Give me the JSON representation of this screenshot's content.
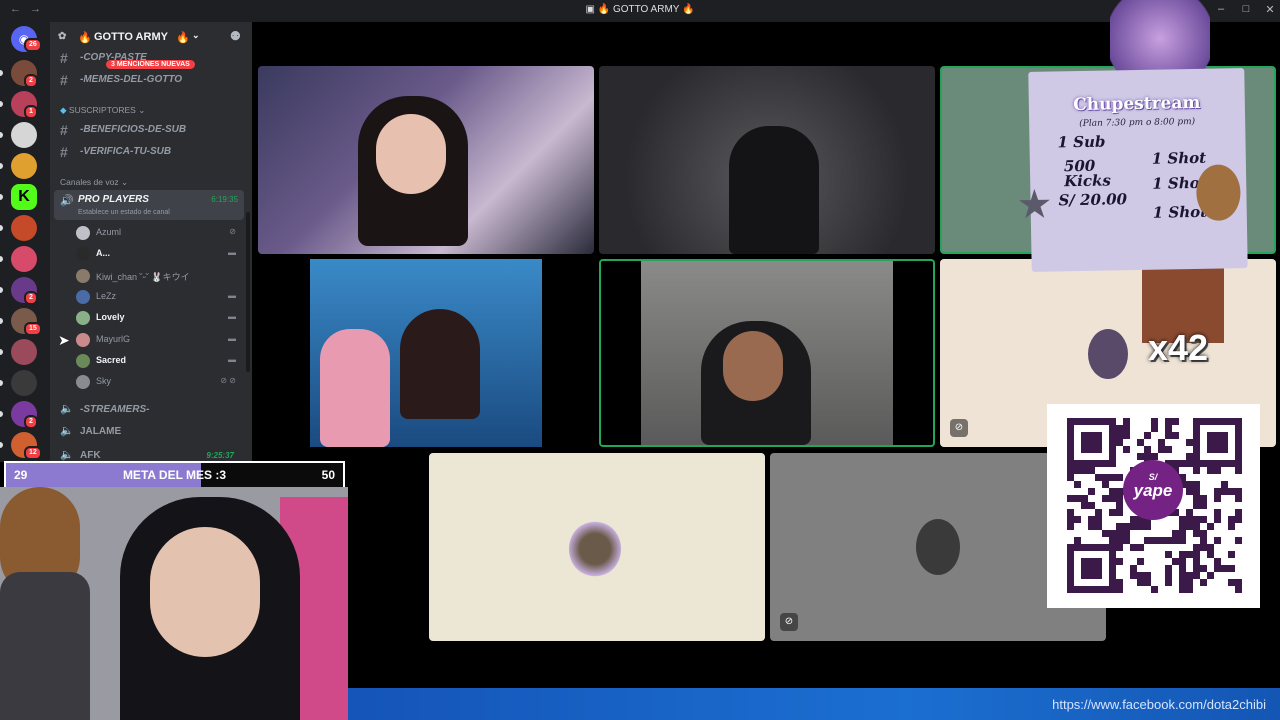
{
  "window": {
    "title": "GOTTO ARMY",
    "title_icon": "fire-emoji",
    "accent": "#5865f2"
  },
  "rail": {
    "home_badge": "26",
    "servers": [
      {
        "badge": "2",
        "color": "#7a4b3a"
      },
      {
        "badge": "1",
        "color": "#b8405a"
      },
      {
        "badge": "",
        "color": "#d6d6d6"
      },
      {
        "badge": "",
        "color": "#e0a030"
      },
      {
        "badge": "",
        "color": "#53fc18",
        "letter": "K"
      },
      {
        "badge": "",
        "color": "#c44a2a"
      },
      {
        "badge": "",
        "color": "#d84a6a"
      },
      {
        "badge": "2",
        "color": "#6a3a8a"
      },
      {
        "badge": "15",
        "color": "#7a5a4a"
      },
      {
        "badge": "",
        "color": "#9a4a5a"
      },
      {
        "badge": "",
        "color": "#3a3a3a"
      },
      {
        "badge": "2",
        "color": "#7a3aa0"
      },
      {
        "badge": "12",
        "color": "#d06030"
      }
    ]
  },
  "sidebar": {
    "server_name": "GOTTO ARMY",
    "mention_banner": "3 MENCIONES NUEVAS",
    "top_channels": [
      "-COPY-PASTE",
      "-MEMES-DEL-GOTTO"
    ],
    "category_subs": "SUSCRIPTORES",
    "sub_channels": [
      "-BENEFICIOS-DE-SUB",
      "-VERIFICA-TU-SUB"
    ],
    "category_voice": "Canales de voz",
    "voice_channel": {
      "name": "PRO PLAYERS",
      "timer": "6:19:35",
      "status_hint": "Establece un estado de canal"
    },
    "voice_users": [
      {
        "name": "Azuml",
        "color": "#c0c0c8",
        "status": "muted"
      },
      {
        "name": "A...",
        "color": "#2a2a2a",
        "status": "video"
      },
      {
        "name": "Kiwi_chan ˘ᵕ˘ 🐰キウイ",
        "color": "#8a7a6a",
        "status": ""
      },
      {
        "name": "LeZz",
        "color": "#4a6aa8",
        "status": "video"
      },
      {
        "name": "Lovely",
        "color": "#8ab088",
        "status": "video"
      },
      {
        "name": "MayurlG",
        "color": "#c88a8a",
        "status": "video"
      },
      {
        "name": "Sacred",
        "color": "#6a8a5a",
        "status": "video"
      },
      {
        "name": "Sky",
        "color": "#8a8a90",
        "status": "muted-deaf"
      }
    ],
    "other_voice": [
      "-STREAMERS-",
      "JALAME",
      "AFK"
    ],
    "afk_timer": "9:25:37"
  },
  "overlay": {
    "goal": {
      "label": "META DEL MES :3",
      "current": "29",
      "target": "50",
      "progress": 0.58
    },
    "card": {
      "title": "Chupestream",
      "subtitle": "(Plan 7:30 pm o 8:00 pm)",
      "rows": [
        {
          "left": "1 Sub",
          "right": "1 Shot"
        },
        {
          "left": "500 Kicks",
          "right": "1 Shot"
        },
        {
          "left": "S/ 20.00",
          "right": "1 Shot"
        }
      ]
    },
    "multiplier": "x42",
    "qr_brand": "yape",
    "qr_symbol": "S/",
    "footer_url": "https://www.facebook.com/dota2chibi"
  }
}
